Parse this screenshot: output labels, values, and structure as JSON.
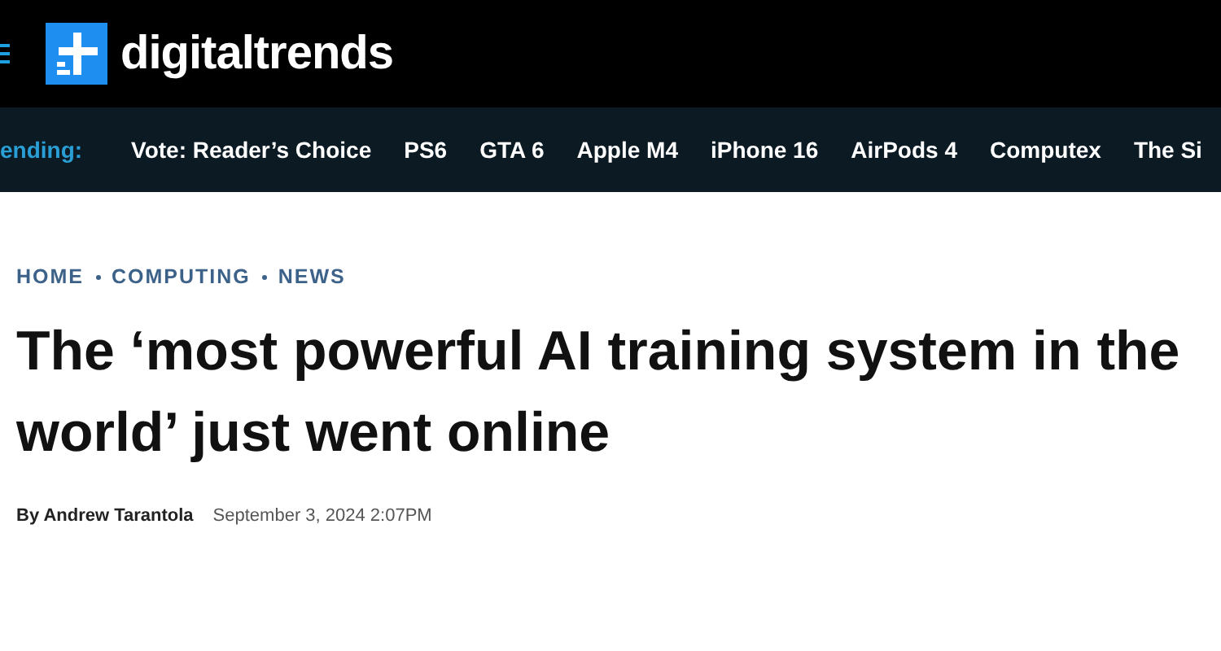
{
  "header": {
    "logo_text": "digitaltrends"
  },
  "trending": {
    "label": "ending:",
    "items": [
      "Vote: Reader’s Choice",
      "PS6",
      "GTA 6",
      "Apple M4",
      "iPhone 16",
      "AirPods 4",
      "Computex",
      "The Si"
    ]
  },
  "breadcrumbs": [
    "HOME",
    "COMPUTING",
    "NEWS"
  ],
  "headline": "The ‘most powerful AI training system in the world’ just went online",
  "byline": {
    "author": "By Andrew Tarantola",
    "date": "September 3, 2024 2:07PM"
  }
}
